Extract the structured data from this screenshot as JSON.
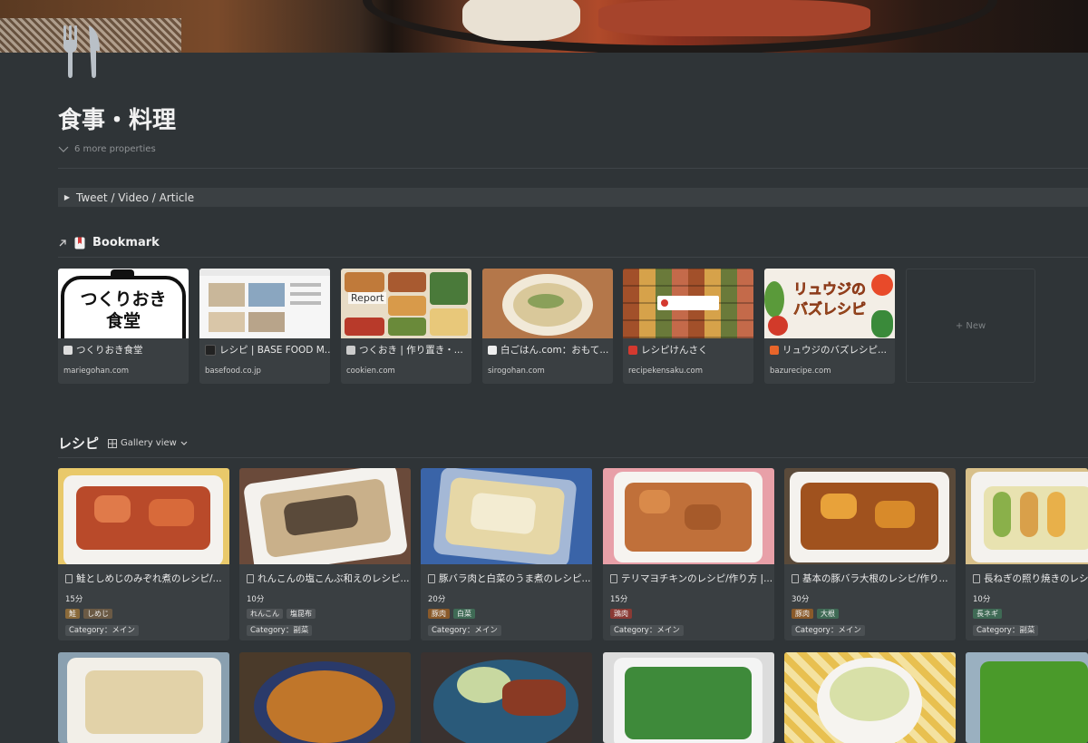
{
  "page": {
    "title": "食事・料理",
    "more_properties": "6 more properties",
    "toggle_label": "Tweet / Video / Article"
  },
  "bookmark": {
    "title": "Bookmark",
    "new_label": "+ New",
    "cards": [
      {
        "title": "つくりおき食堂",
        "url": "mariegohan.com"
      },
      {
        "title": "レシピ | BASE FOOD M...",
        "url": "basefood.co.jp"
      },
      {
        "title": "つくおき | 作り置き・...",
        "url": "cookien.com"
      },
      {
        "title": "白ごはん.com：おもて...",
        "url": "sirogohan.com"
      },
      {
        "title": "レシピけんさく",
        "url": "recipekensaku.com"
      },
      {
        "title": "リュウジのバズレシピ...",
        "url": "bazurecipe.com"
      }
    ],
    "thumb_text": {
      "mariegohan_line1": "つくりおき",
      "mariegohan_line2": "食堂",
      "cookien": "Report",
      "bazurecipe_line1": "リュウジの",
      "bazurecipe_line2": "バズレシピ"
    }
  },
  "recipes": {
    "title": "レシピ",
    "view_label": "Gallery view",
    "cards": [
      {
        "title": "鮭としめじのみぞれ煮のレシピ/...",
        "time": "15分",
        "tags": [
          {
            "label": "鮭",
            "color": "#8a6a3a"
          },
          {
            "label": "しめじ",
            "color": "#6b5a45"
          }
        ],
        "category": "Category：メイン"
      },
      {
        "title": "れんこんの塩こんぶ和えのレシピ...",
        "time": "10分",
        "tags": [
          {
            "label": "れんこん",
            "color": "#4f5356"
          },
          {
            "label": "塩昆布",
            "color": "#4f5356"
          }
        ],
        "category": "Category：副菜"
      },
      {
        "title": "豚バラ肉と白菜のうま煮のレシピ...",
        "time": "20分",
        "tags": [
          {
            "label": "豚肉",
            "color": "#8a5a2a"
          },
          {
            "label": "白菜",
            "color": "#3f6a55"
          }
        ],
        "category": "Category：メイン"
      },
      {
        "title": "テリマヨチキンのレシピ/作り方 |...",
        "time": "15分",
        "tags": [
          {
            "label": "鶏肉",
            "color": "#8a3a34"
          }
        ],
        "category": "Category：メイン"
      },
      {
        "title": "基本の豚バラ大根のレシピ/作り...",
        "time": "30分",
        "tags": [
          {
            "label": "豚肉",
            "color": "#8a5a2a"
          },
          {
            "label": "大根",
            "color": "#3f6a55"
          }
        ],
        "category": "Category：メイン"
      },
      {
        "title": "長ねぎの照り焼きのレシピ",
        "time": "10分",
        "tags": [
          {
            "label": "長ネギ",
            "color": "#3f6a55"
          }
        ],
        "category": "Category：副菜"
      }
    ]
  }
}
